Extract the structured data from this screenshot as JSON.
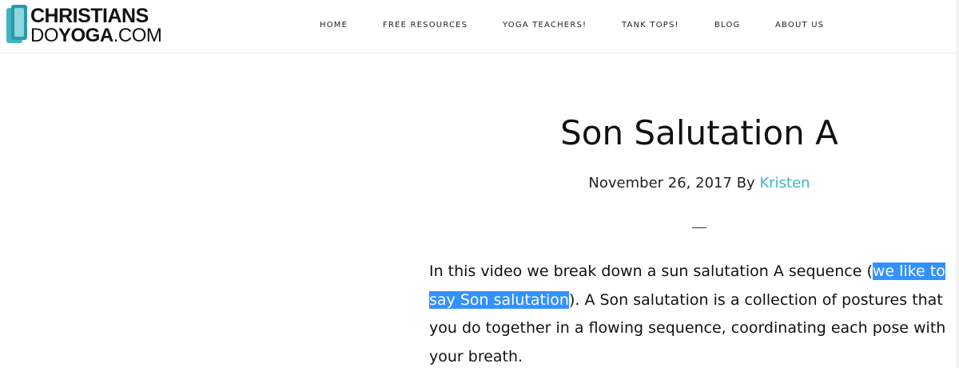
{
  "header": {
    "logo": {
      "line1": "CHRISTIANS",
      "line2_prefix": "DO",
      "line2_bold": "YOGA",
      "line2_suffix": ".COM"
    },
    "nav": [
      {
        "label": "HOME"
      },
      {
        "label": "FREE RESOURCES"
      },
      {
        "label": "YOGA TEACHERS!"
      },
      {
        "label": "TANK TOPS!"
      },
      {
        "label": "BLOG"
      },
      {
        "label": "ABOUT US"
      }
    ]
  },
  "post": {
    "title": "Son Salutation A",
    "date": "November 26, 2017",
    "by": "By",
    "author": "Kristen",
    "body": {
      "line1_a": "In this video we break down a sun salutation A sequence (",
      "line1_sel": "we like to",
      "line2_sel": "say Son salutation",
      "line2_b": "). A Son salutation is a collection of postures that",
      "line3": "you do together in a flowing sequence, coordinating each pose with",
      "line4": "your breath."
    }
  },
  "colors": {
    "accent": "#41b3c7",
    "selection": "#3390ff",
    "logo_teal": "#3fb5c4"
  }
}
